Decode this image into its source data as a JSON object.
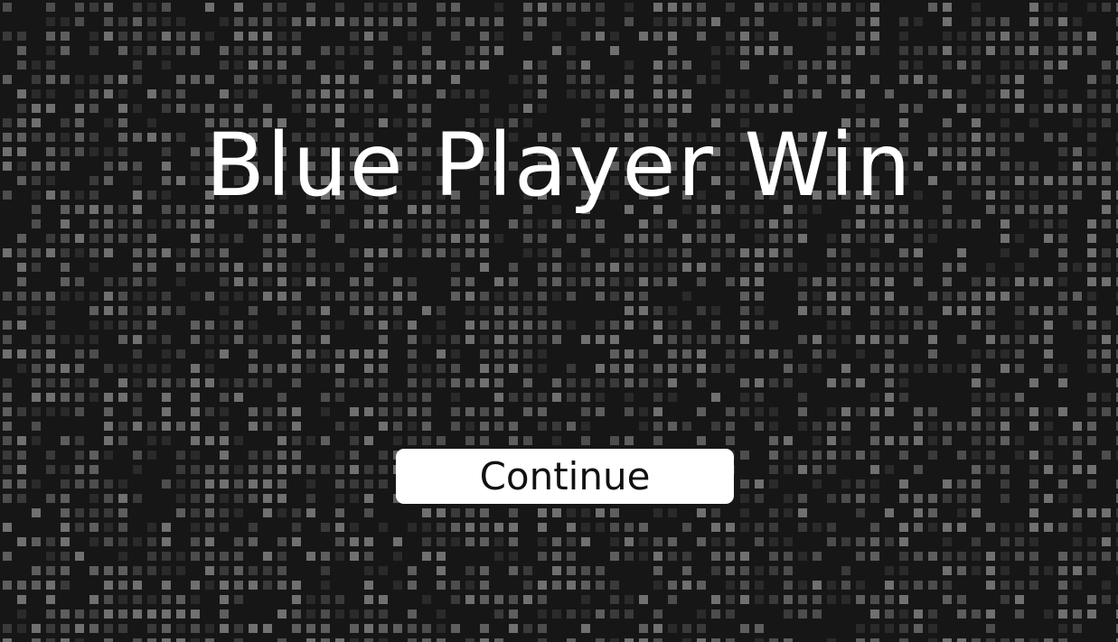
{
  "game": {
    "result_title": "Blue Player Win",
    "continue_label": "Continue"
  },
  "background": {
    "pattern": "pixel-grid",
    "base_color": "#161616",
    "tile_colors": [
      "#2a2a2a",
      "#3a3a3a",
      "#4d4d4d",
      "#5e5e5e",
      "#707070"
    ]
  }
}
